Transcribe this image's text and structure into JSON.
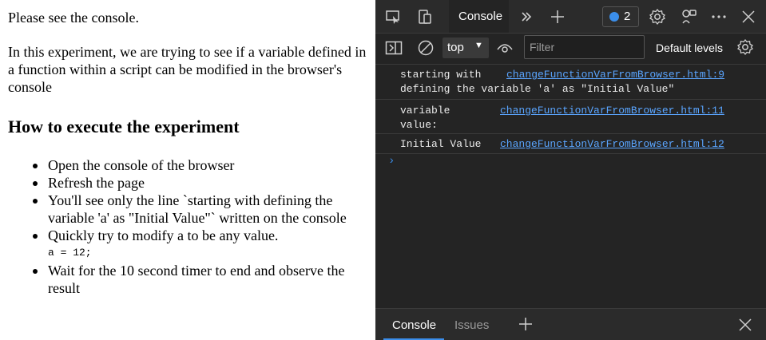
{
  "page": {
    "intro": "Please see the console.",
    "description": "In this experiment, we are trying to see if a variable defined in a function within a script can be modified in the browser's console",
    "heading": "How to execute the experiment",
    "steps": [
      "Open the console of the browser",
      "Refresh the page",
      "You'll see only the line `starting with defining the variable 'a' as \"Initial Value\"` written on the console",
      "Quickly try to modify a to be any value.",
      "Wait for the 10 second timer to end and observe the result"
    ],
    "code": "a = 12;"
  },
  "devtools": {
    "tabs": {
      "console": "Console"
    },
    "issues_count": "2",
    "toolbar": {
      "context": "top",
      "filter_placeholder": "Filter",
      "levels": "Default levels"
    },
    "messages": [
      {
        "text": "starting with\ndefining the variable 'a' as \"Initial Value\"",
        "source": "changeFunctionVarFromBrowser.html:9"
      },
      {
        "text": "variable\nvalue:",
        "source": "changeFunctionVarFromBrowser.html:11"
      },
      {
        "text": "Initial Value",
        "source": "changeFunctionVarFromBrowser.html:12"
      }
    ],
    "prompt": "›",
    "drawer": {
      "console": "Console",
      "issues": "Issues"
    }
  },
  "colors": {
    "accent": "#3b8eea",
    "link": "#5aa5ff",
    "panel_bg": "#242424"
  }
}
